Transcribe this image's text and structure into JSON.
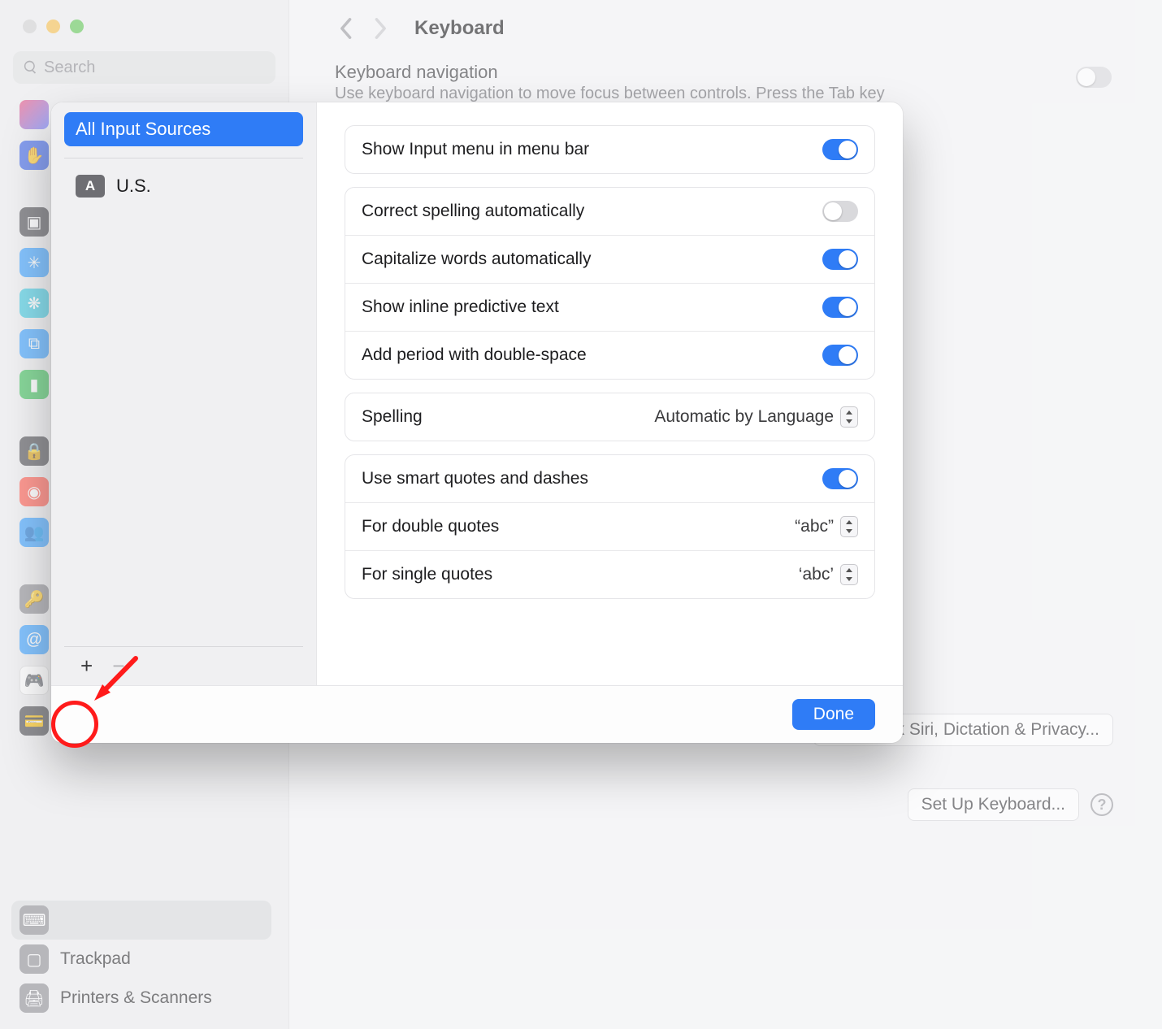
{
  "window": {
    "search_placeholder": "Search",
    "title": "Keyboard",
    "section_title": "Keyboard navigation",
    "section_sub": "Use keyboard navigation to move focus between controls. Press the Tab key",
    "about_btn": "About Ask Siri, Dictation & Privacy...",
    "setup_btn": "Set Up Keyboard...",
    "sidebar": {
      "trackpad": "Trackpad",
      "printers": "Printers & Scanners"
    }
  },
  "sheet": {
    "left": {
      "active": "All Input Sources",
      "source_name": "U.S.",
      "source_badge": "A",
      "add_label": "+",
      "remove_label": "−"
    },
    "rows": {
      "show_input_menu": "Show Input menu in menu bar",
      "correct_spelling": "Correct spelling automatically",
      "capitalize": "Capitalize words automatically",
      "predictive": "Show inline predictive text",
      "double_space": "Add period with double-space",
      "spelling_label": "Spelling",
      "spelling_value": "Automatic by Language",
      "smart_quotes": "Use smart quotes and dashes",
      "double_quotes_label": "For double quotes",
      "double_quotes_value": "“abc”",
      "single_quotes_label": "For single quotes",
      "single_quotes_value": "‘abc’"
    },
    "done": "Done"
  }
}
